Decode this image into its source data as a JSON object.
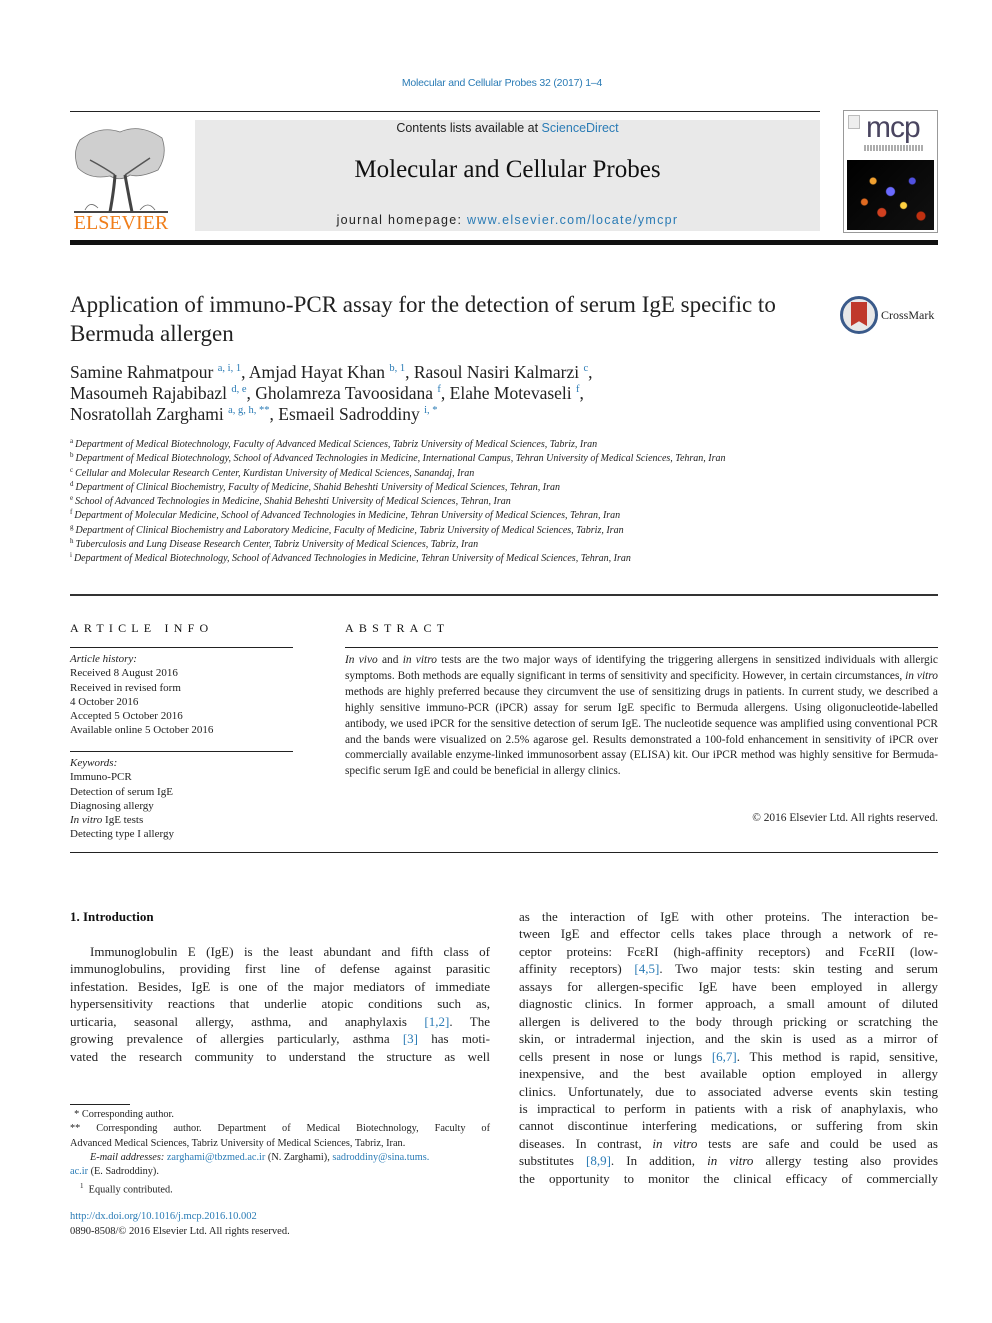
{
  "citation": "Molecular and Cellular Probes 32 (2017) 1–4",
  "header": {
    "publisher": "ELSEVIER",
    "contents_prefix": "Contents lists available at ",
    "contents_link": "ScienceDirect",
    "journal_title": "Molecular and Cellular Probes",
    "homepage_prefix": "journal homepage: ",
    "homepage_link": "www.elsevier.com/locate/ymcpr",
    "cover_logo": "mcp"
  },
  "article": {
    "title": "Application of immuno-PCR assay for the detection of serum IgE specific to Bermuda allergen",
    "crossmark": "CrossMark",
    "authors": [
      {
        "name": "Samine Rahmatpour",
        "sup": "a, i, 1",
        "sep": ", "
      },
      {
        "name": "Amjad Hayat Khan",
        "sup": "b, 1",
        "sep": ", "
      },
      {
        "name": "Rasoul Nasiri Kalmarzi",
        "sup": "c",
        "sep": ","
      },
      {
        "name": "Masoumeh Rajabibazl",
        "sup": "d, e",
        "sep": ", "
      },
      {
        "name": "Gholamreza Tavoosidana",
        "sup": "f",
        "sep": ", "
      },
      {
        "name": "Elahe Motevaseli",
        "sup": "f",
        "sep": ","
      },
      {
        "name": "Nosratollah Zarghami",
        "sup": "a, g, h, **",
        "sep": ", "
      },
      {
        "name": "Esmaeil Sadroddiny",
        "sup": "i, *",
        "sep": ""
      }
    ],
    "affiliations": [
      {
        "key": "a",
        "text": "Department of Medical Biotechnology, Faculty of Advanced Medical Sciences, Tabriz University of Medical Sciences, Tabriz, Iran"
      },
      {
        "key": "b",
        "text": "Department of Medical Biotechnology, School of Advanced Technologies in Medicine, International Campus, Tehran University of Medical Sciences, Tehran, Iran"
      },
      {
        "key": "c",
        "text": "Cellular and Molecular Research Center, Kurdistan University of Medical Sciences, Sanandaj, Iran"
      },
      {
        "key": "d",
        "text": "Department of Clinical Biochemistry, Faculty of Medicine, Shahid Beheshti University of Medical Sciences, Tehran, Iran"
      },
      {
        "key": "e",
        "text": "School of Advanced Technologies in Medicine, Shahid Beheshti University of Medical Sciences, Tehran, Iran"
      },
      {
        "key": "f",
        "text": "Department of Molecular Medicine, School of Advanced Technologies in Medicine, Tehran University of Medical Sciences, Tehran, Iran"
      },
      {
        "key": "g",
        "text": "Department of Clinical Biochemistry and Laboratory Medicine, Faculty of Medicine, Tabriz University of Medical Sciences, Tabriz, Iran"
      },
      {
        "key": "h",
        "text": "Tuberculosis and Lung Disease Research Center, Tabriz University of Medical Sciences, Tabriz, Iran"
      },
      {
        "key": "i",
        "text": "Department of Medical Biotechnology, School of Advanced Technologies in Medicine, Tehran University of Medical Sciences, Tehran, Iran"
      }
    ]
  },
  "article_info": {
    "heading": "ARTICLE INFO",
    "history_label": "Article history:",
    "history": [
      "Received 8 August 2016",
      "Received in revised form",
      "4 October 2016",
      "Accepted 5 October 2016",
      "Available online 5 October 2016"
    ],
    "keywords_label": "Keywords:",
    "keywords": [
      {
        "italic": "",
        "text": "Immuno-PCR"
      },
      {
        "italic": "",
        "text": "Detection of serum IgE"
      },
      {
        "italic": "",
        "text": "Diagnosing allergy"
      },
      {
        "italic": "In vitro",
        "text": " IgE tests"
      },
      {
        "italic": "",
        "text": "Detecting type I allergy"
      }
    ]
  },
  "abstract": {
    "heading": "ABSTRACT",
    "segments": [
      {
        "i": "In vivo"
      },
      {
        "t": " and "
      },
      {
        "i": "in vitro"
      },
      {
        "t": " tests are the two major ways of identifying the triggering allergens in sensitized individuals with allergic symptoms. Both methods are equally significant in terms of sensitivity and specificity. However, in certain circumstances, "
      },
      {
        "i": "in vitro"
      },
      {
        "t": " methods are highly preferred because they circumvent the use of sensitizing drugs in patients. In current study, we described a highly sensitive immuno-PCR (iPCR) assay for serum IgE specific to Bermuda allergens. Using oligonucleotide-labelled antibody, we used iPCR for the sensitive detection of serum IgE. The nucleotide sequence was ampli­fied using conventional PCR and the bands were visualized on 2.5% agarose gel. Results demonstrated a 100-fold enhancement in sensitivity of iPCR over commercially available enzyme-linked immunosorbent assay (ELISA) kit. Our iPCR method was highly sensitive for Bermuda-specific serum IgE and could be beneficial in allergy clinics."
      }
    ],
    "copyright": "© 2016 Elsevier Ltd. All rights reserved."
  },
  "body": {
    "section_heading": "1.  Introduction",
    "left_lines": [
      [
        {
          "t": "Immunoglobulin E (IgE) is the least abundant and fifth class of"
        }
      ],
      [
        {
          "t": "immunoglobulins, providing first line of defense against parasitic"
        }
      ],
      [
        {
          "t": "infestation. Besides, IgE is one of the major mediators of immediate"
        }
      ],
      [
        {
          "t": "hypersensitivity reactions that underlie atopic conditions such as,"
        }
      ],
      [
        {
          "t": "urticaria, seasonal allergy, asthma, and anaphylaxis "
        },
        {
          "c": "[1,2]"
        },
        {
          "t": ". The"
        }
      ],
      [
        {
          "t": "growing prevalence of allergies particularly, asthma "
        },
        {
          "c": "[3]"
        },
        {
          "t": " has moti-"
        }
      ],
      [
        {
          "t": "vated the research community to understand the structure as well"
        }
      ]
    ],
    "right_lines": [
      [
        {
          "t": "as the interaction of IgE with other proteins. The interaction be-"
        }
      ],
      [
        {
          "t": "tween IgE and effector cells takes place through a network of re-"
        }
      ],
      [
        {
          "t": "ceptor proteins: FcεRI (high-affinity receptors) and FcεRII (low-"
        }
      ],
      [
        {
          "t": "affinity receptors) "
        },
        {
          "c": "[4,5]"
        },
        {
          "t": ". Two major tests: skin testing and serum"
        }
      ],
      [
        {
          "t": "assays for allergen-specific IgE have been employed in allergy"
        }
      ],
      [
        {
          "t": "diagnostic clinics. In former approach, a small amount of diluted"
        }
      ],
      [
        {
          "t": "allergen is delivered to the body through pricking or scratching the"
        }
      ],
      [
        {
          "t": "skin, or intradermal injection, and the skin is used as a mirror of"
        }
      ],
      [
        {
          "t": "cells present in nose or lungs "
        },
        {
          "c": "[6,7]"
        },
        {
          "t": ". This method is rapid, sensitive,"
        }
      ],
      [
        {
          "t": "inexpensive, and the best available option employed in allergy"
        }
      ],
      [
        {
          "t": "clinics. Unfortunately, due to associated adverse events skin testing"
        }
      ],
      [
        {
          "t": "is impractical to perform in patients with a risk of anaphylaxis, who"
        }
      ],
      [
        {
          "t": "cannot discontinue interfering medications, or suffering from skin"
        }
      ],
      [
        {
          "t": "diseases. In contrast, "
        },
        {
          "i": "in vitro"
        },
        {
          "t": " tests are safe and could be used as"
        }
      ],
      [
        {
          "t": "substitutes "
        },
        {
          "c": "[8,9]"
        },
        {
          "t": ". In addition, "
        },
        {
          "i": "in vitro"
        },
        {
          "t": " allergy testing also provides"
        }
      ],
      [
        {
          "t": "the opportunity to monitor the clinical efficacy of commercially"
        }
      ]
    ]
  },
  "footnotes": {
    "corresponding1": "  * Corresponding author.",
    "corresponding2_line1": "** Corresponding author. Department of Medical Biotechnology, Faculty of",
    "corresponding2_line2": "Advanced Medical Sciences, Tabriz University of Medical Sciences, Tabriz, Iran.",
    "email_label": "E-mail addresses:",
    "email1": "zarghami@tbzmed.ac.ir",
    "email1_name": " (N. Zarghami), ",
    "email2_part1": "sadroddiny@sina.tums.",
    "email2_part2": "ac.ir",
    "email2_name": " (E. Sadroddiny).",
    "equal": "Equally contributed.",
    "equal_mark": "1"
  },
  "doi": "http://dx.doi.org/10.1016/j.mcp.2016.10.002",
  "issn": "0890-8508/© 2016 Elsevier Ltd. All rights reserved.",
  "colors": {
    "link": "#2a7bb5",
    "elsevier_orange": "#f07e1a",
    "header_gray": "#e9e9e9",
    "crossmark_red": "#c0392b"
  }
}
